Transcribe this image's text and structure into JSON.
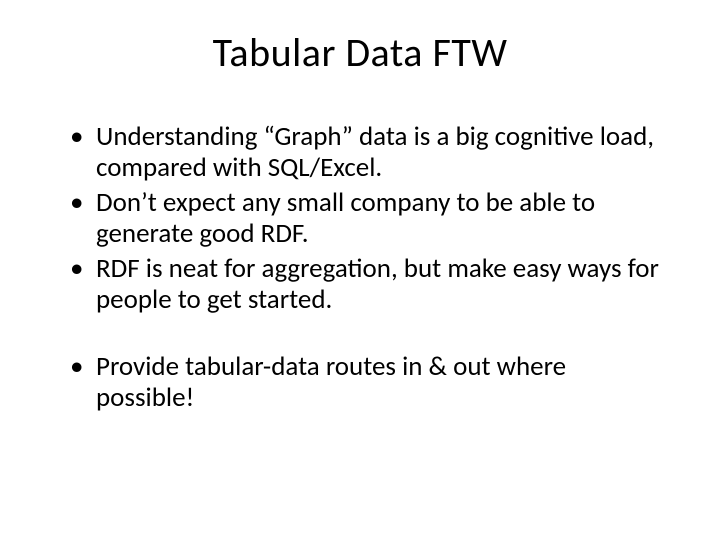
{
  "slide": {
    "title": "Tabular Data FTW",
    "bullets": [
      "Understanding “Graph” data is a big cognitive load, compared with SQL/Excel.",
      "Don’t expect any small company to be able to generate good RDF.",
      "RDF is neat for aggregation, but make easy ways for people to get started.",
      "Provide tabular-data routes in & out where possible!"
    ]
  }
}
